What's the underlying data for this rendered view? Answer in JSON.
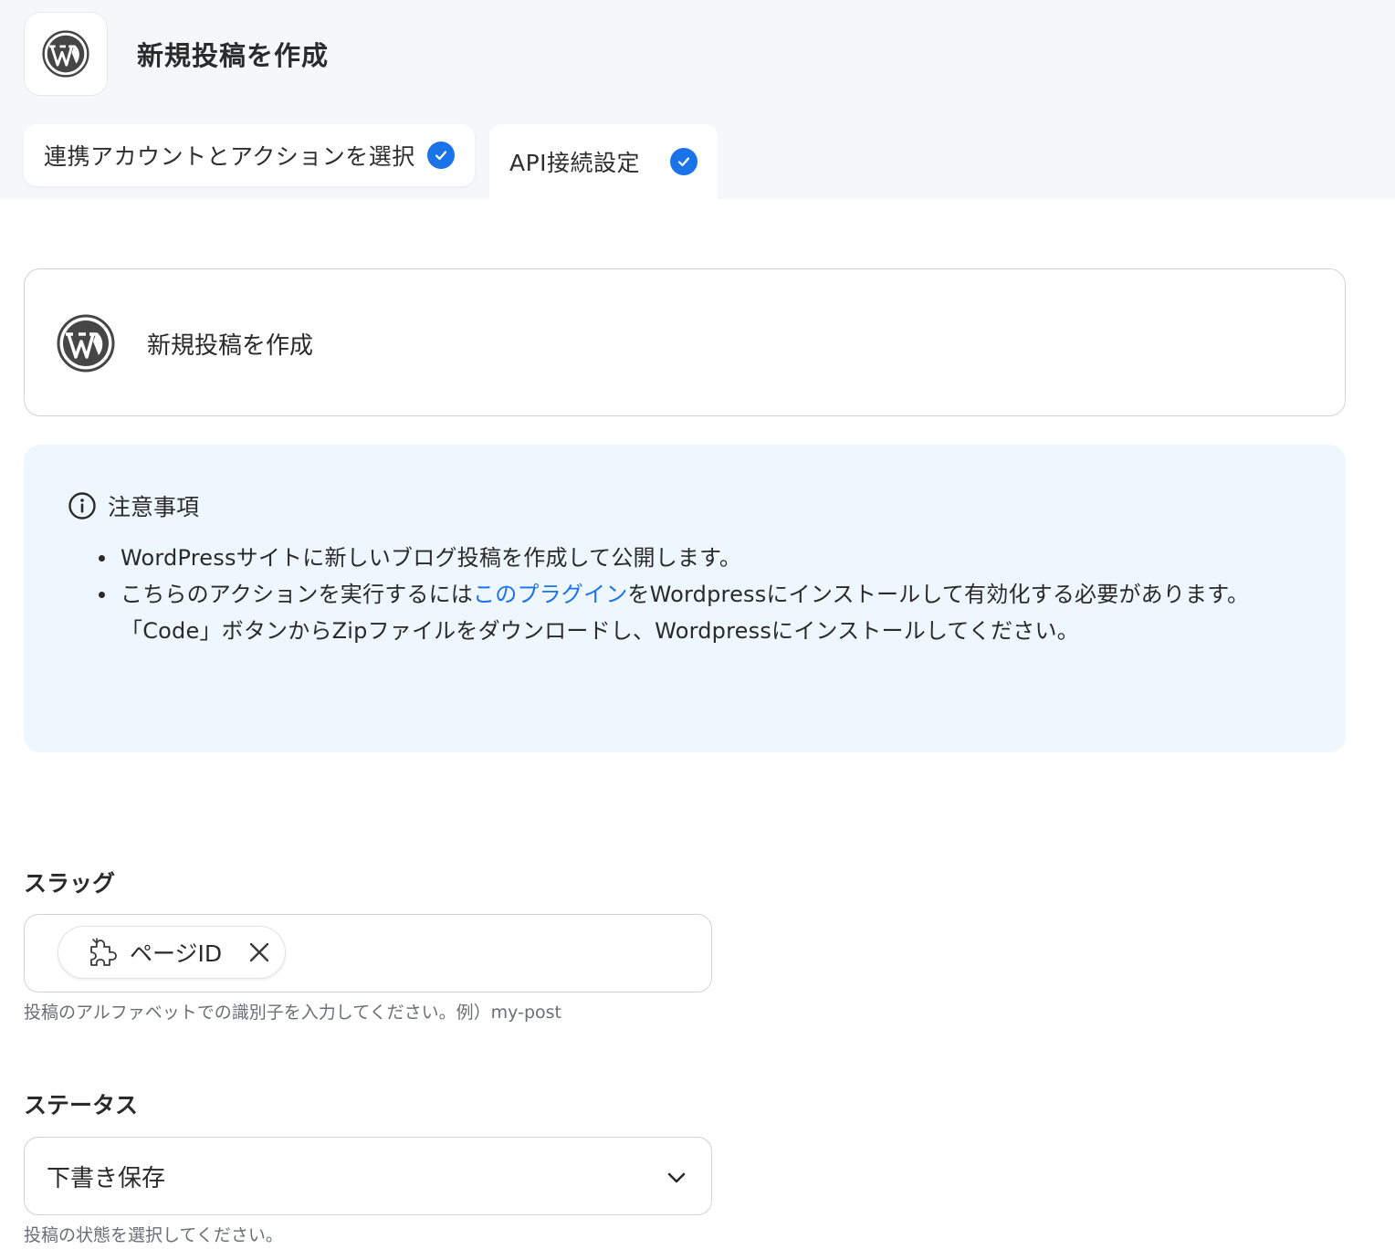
{
  "header": {
    "title": "新規投稿を作成",
    "app_icon": "wordpress-icon"
  },
  "tabs": [
    {
      "label": "連携アカウントとアクションを選択",
      "done": true
    },
    {
      "label": "API接続設定",
      "done": true,
      "active": true
    }
  ],
  "action_card": {
    "icon": "wordpress-icon",
    "name": "新規投稿を作成"
  },
  "notice": {
    "title": "注意事項",
    "items": [
      {
        "text": "WordPressサイトに新しいブログ投稿を作成して公開します。"
      },
      {
        "pre": "こちらのアクションを実行するには",
        "link": "このプラグイン",
        "post": "をWordpressにインストールして有効化する必要があります。",
        "line2": "「Code」ボタンからZipファイルをダウンロードし、Wordpressにインストールしてください。"
      }
    ]
  },
  "slug": {
    "label": "スラッグ",
    "chip_label": "ページID",
    "chip_icon": "puzzle-icon",
    "help": "投稿のアルファベットでの識別子を入力してください。例）my-post"
  },
  "status": {
    "label": "ステータス",
    "value": "下書き保存",
    "help": "投稿の状態を選択してください。"
  },
  "colors": {
    "accent": "#1a73e8",
    "notice_bg": "#eef6fe",
    "header_bg": "#f6f7f9"
  }
}
